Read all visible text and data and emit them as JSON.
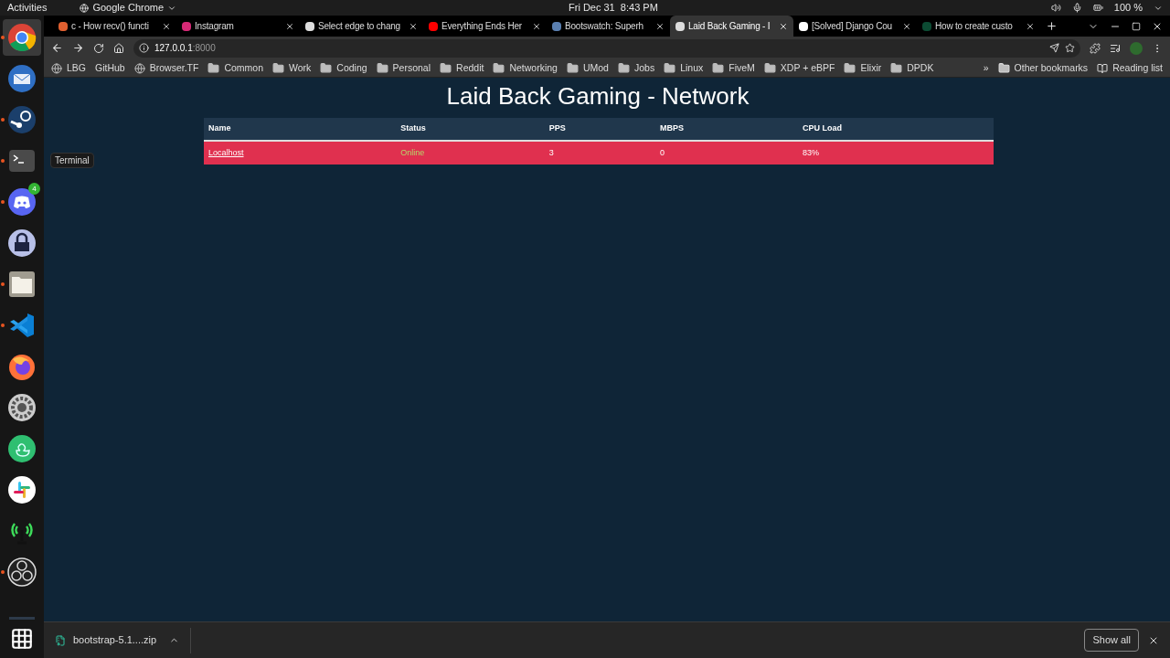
{
  "top_bar": {
    "activities": "Activities",
    "app_menu": "Google Chrome",
    "clock": "Fri Dec 31  8:43 PM",
    "battery": "100 %"
  },
  "dock": [
    {
      "kind": "chrome",
      "running": true,
      "selected": true
    },
    {
      "kind": "mail",
      "running": false,
      "selected": false
    },
    {
      "kind": "steam",
      "running": true,
      "selected": false
    },
    {
      "kind": "terminal",
      "running": true,
      "selected": false,
      "tooltip": "Terminal"
    },
    {
      "kind": "discord",
      "running": true,
      "selected": false,
      "badge": "4"
    },
    {
      "kind": "lock",
      "running": false,
      "selected": false
    },
    {
      "kind": "files",
      "running": true,
      "selected": false
    },
    {
      "kind": "code",
      "running": true,
      "selected": false
    },
    {
      "kind": "firefox",
      "running": false,
      "selected": false
    },
    {
      "kind": "settings",
      "running": false,
      "selected": false
    },
    {
      "kind": "duck",
      "running": false,
      "selected": false
    },
    {
      "kind": "slack",
      "running": false,
      "selected": false
    },
    {
      "kind": "antenna",
      "running": false,
      "selected": false
    },
    {
      "kind": "obs",
      "running": true,
      "selected": false
    }
  ],
  "tabs": [
    {
      "title": "c - How recv() functi",
      "selected": false,
      "color": "#e06030"
    },
    {
      "title": "Instagram",
      "selected": false,
      "color": "#d62976"
    },
    {
      "title": "Select edge to chang",
      "selected": false,
      "color": "#dddddd"
    },
    {
      "title": "Everything Ends Her",
      "selected": false,
      "color": "#ff0000"
    },
    {
      "title": "Bootswatch: Superh",
      "selected": false,
      "color": "#5a7fb0"
    },
    {
      "title": "Laid Back Gaming - I",
      "selected": true,
      "color": "#dddddd"
    },
    {
      "title": "[Solved] Django Cou",
      "selected": false,
      "color": "#ffffff"
    },
    {
      "title": "How to create custo",
      "selected": false,
      "color": "#0c4b33"
    }
  ],
  "address": {
    "host": "127.0.0.1",
    "port": ":8000"
  },
  "bookmarks": [
    {
      "kind": "site",
      "label": "LBG"
    },
    {
      "kind": "plain",
      "label": "GitHub"
    },
    {
      "kind": "site",
      "label": "Browser.TF"
    },
    {
      "kind": "folder",
      "label": "Common"
    },
    {
      "kind": "folder",
      "label": "Work"
    },
    {
      "kind": "folder",
      "label": "Coding"
    },
    {
      "kind": "folder",
      "label": "Personal"
    },
    {
      "kind": "folder",
      "label": "Reddit"
    },
    {
      "kind": "folder",
      "label": "Networking"
    },
    {
      "kind": "folder",
      "label": "UMod"
    },
    {
      "kind": "folder",
      "label": "Jobs"
    },
    {
      "kind": "folder",
      "label": "Linux"
    },
    {
      "kind": "folder",
      "label": "FiveM"
    },
    {
      "kind": "folder",
      "label": "XDP + eBPF"
    },
    {
      "kind": "folder",
      "label": "Elixir"
    },
    {
      "kind": "folder",
      "label": "DPDK"
    }
  ],
  "bookmarks_more": "»",
  "other_bookmarks": "Other bookmarks",
  "reading_list": "Reading list",
  "page": {
    "title": "Laid Back Gaming - Network",
    "table": {
      "columns": [
        "Name",
        "Status",
        "PPS",
        "MBPS",
        "CPU Load"
      ],
      "rows": [
        {
          "name": "Localhost",
          "status": "Online",
          "pps": "3",
          "mbps": "0",
          "cpu_load": "83%",
          "color": "#e0304f"
        }
      ]
    }
  },
  "download_bar": {
    "file": "bootstrap-5.1....zip",
    "show_all": "Show all"
  }
}
